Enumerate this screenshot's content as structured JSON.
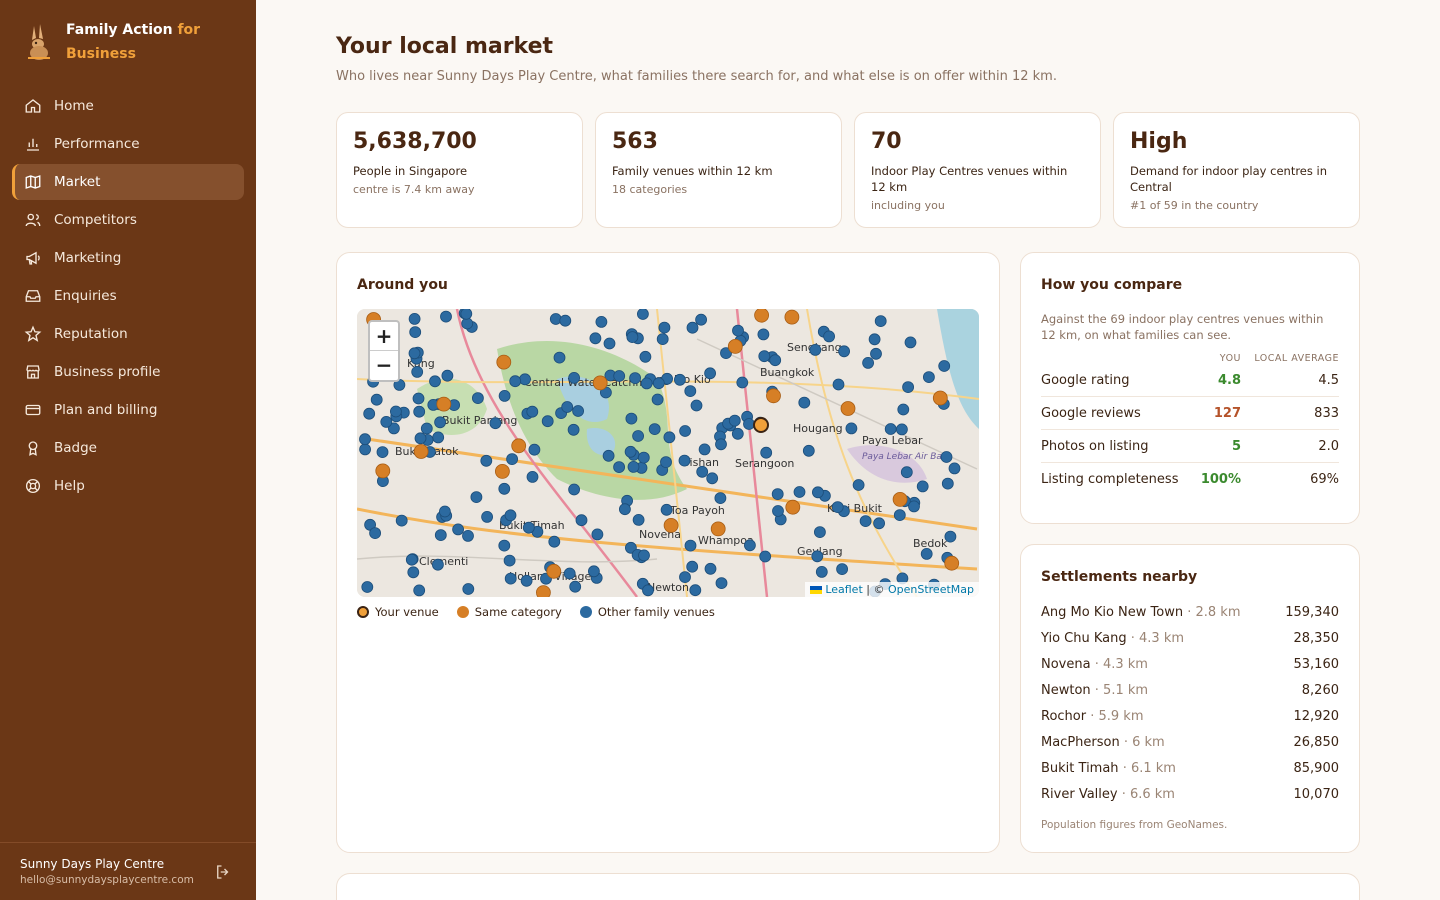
{
  "brand": {
    "line1": "Family Action",
    "line1_accent": "for",
    "line2": "Business"
  },
  "nav": [
    {
      "label": "Home",
      "icon": "home-icon"
    },
    {
      "label": "Performance",
      "icon": "bar-chart-icon"
    },
    {
      "label": "Market",
      "icon": "map-icon",
      "active": true
    },
    {
      "label": "Competitors",
      "icon": "users-icon"
    },
    {
      "label": "Marketing",
      "icon": "megaphone-icon"
    },
    {
      "label": "Enquiries",
      "icon": "inbox-icon"
    },
    {
      "label": "Reputation",
      "icon": "star-icon"
    },
    {
      "label": "Business profile",
      "icon": "storefront-icon"
    },
    {
      "label": "Plan and billing",
      "icon": "credit-card-icon"
    },
    {
      "label": "Badge",
      "icon": "award-icon"
    },
    {
      "label": "Help",
      "icon": "lifebuoy-icon"
    }
  ],
  "account": {
    "name": "Sunny Days Play Centre",
    "email": "hello@sunnydaysplaycentre.com"
  },
  "page": {
    "title": "Your local market",
    "subtitle": "Who lives near Sunny Days Play Centre, what families there search for, and what else is on offer within 12 km."
  },
  "stats": [
    {
      "value": "5,638,700",
      "label": "People in Singapore",
      "note": "centre is 7.4 km away"
    },
    {
      "value": "563",
      "label": "Family venues within 12 km",
      "note": "18 categories"
    },
    {
      "value": "70",
      "label": "Indoor Play Centres venues within 12 km",
      "note": "including you"
    },
    {
      "value": "High",
      "label": "Demand for indoor play centres in Central",
      "note": "#1 of 59 in the country"
    }
  ],
  "map": {
    "title": "Around you",
    "zoom_in": "+",
    "zoom_out": "−",
    "attrib_leaflet": "Leaflet",
    "attrib_sep": " | © ",
    "attrib_osm": "OpenStreetMap",
    "labels": [
      "Central Water Catchment",
      "Ang Mo Kio",
      "Sengkang",
      "Buangkok",
      "Hougang",
      "Paya Lebar",
      "Bukit Panjang",
      "Bukit Batok",
      "Bukit Timah",
      "Bishan",
      "Serangoon",
      "Toa Payoh",
      "Novena",
      "Whampoa",
      "Kaki Bukit",
      "Bedok",
      "Clementi",
      "Holland Village",
      "Newton",
      "Geylang",
      "Kang",
      "Paya Lebar Air Base"
    ],
    "legend": [
      {
        "label": "Your venue",
        "color": "#f0a03a"
      },
      {
        "label": "Same category",
        "color": "#d67f26"
      },
      {
        "label": "Other family venues",
        "color": "#2c6aa0"
      }
    ]
  },
  "compare": {
    "title": "How you compare",
    "desc": "Against the 69 indoor play centres venues within 12 km, on what families can see.",
    "col_you": "YOU",
    "col_avg": "LOCAL AVERAGE",
    "rows": [
      {
        "label": "Google rating",
        "you": "4.8",
        "avg": "4.5",
        "tone": "good"
      },
      {
        "label": "Google reviews",
        "you": "127",
        "avg": "833",
        "tone": "bad"
      },
      {
        "label": "Photos on listing",
        "you": "5",
        "avg": "2.0",
        "tone": "good"
      },
      {
        "label": "Listing completeness",
        "you": "100%",
        "avg": "69%",
        "tone": "good"
      }
    ]
  },
  "settlements": {
    "title": "Settlements nearby",
    "rows": [
      {
        "name": "Ang Mo Kio New Town",
        "dist": " · 2.8 km",
        "pop": "159,340"
      },
      {
        "name": "Yio Chu Kang",
        "dist": " · 4.3 km",
        "pop": "28,350"
      },
      {
        "name": "Novena",
        "dist": " · 4.3 km",
        "pop": "53,160"
      },
      {
        "name": "Newton",
        "dist": " · 5.1 km",
        "pop": "8,260"
      },
      {
        "name": "Rochor",
        "dist": " · 5.9 km",
        "pop": "12,920"
      },
      {
        "name": "MacPherson",
        "dist": " · 6 km",
        "pop": "26,850"
      },
      {
        "name": "Bukit Timah",
        "dist": " · 6.1 km",
        "pop": "85,900"
      },
      {
        "name": "River Valley",
        "dist": " · 6.6 km",
        "pop": "10,070"
      }
    ],
    "note": "Population figures from GeoNames."
  }
}
